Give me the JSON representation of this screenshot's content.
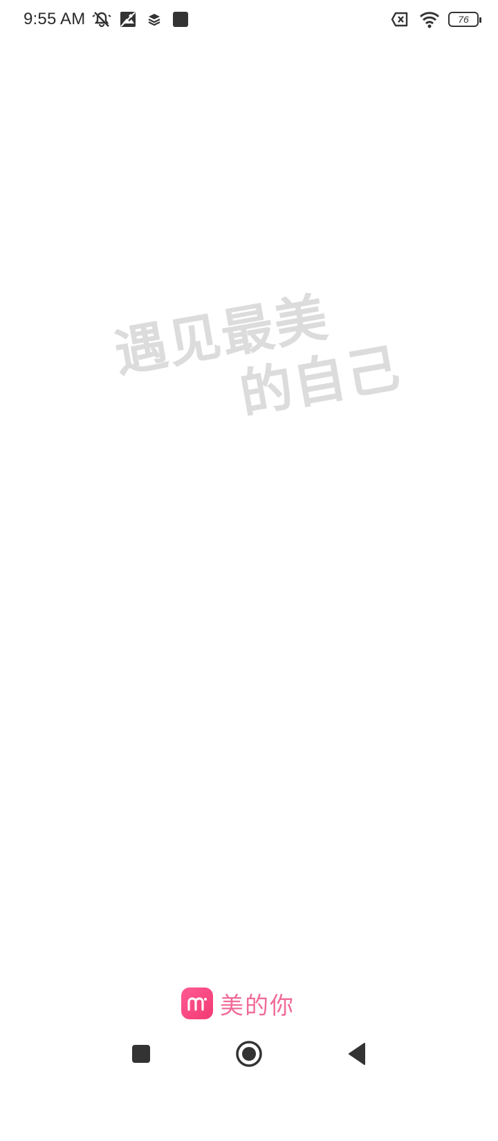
{
  "status_bar": {
    "time": "9:55 AM",
    "battery_level": "76",
    "icons": [
      "muted-bell-icon",
      "photo-icon",
      "layers-icon",
      "square-app-icon",
      "no-sim-icon",
      "wifi-icon",
      "battery-icon"
    ]
  },
  "splash": {
    "slogan_line1": "遇见最美",
    "slogan_line2": "的自己"
  },
  "brand": {
    "name": "美的你",
    "logo_icon": "meidini-logo-icon",
    "color": "#f06a98",
    "logo_gradient": [
      "#ff5a93",
      "#f23a73"
    ]
  },
  "nav_bar": {
    "buttons": [
      "recents-square-icon",
      "home-circle-icon",
      "back-triangle-icon"
    ]
  }
}
